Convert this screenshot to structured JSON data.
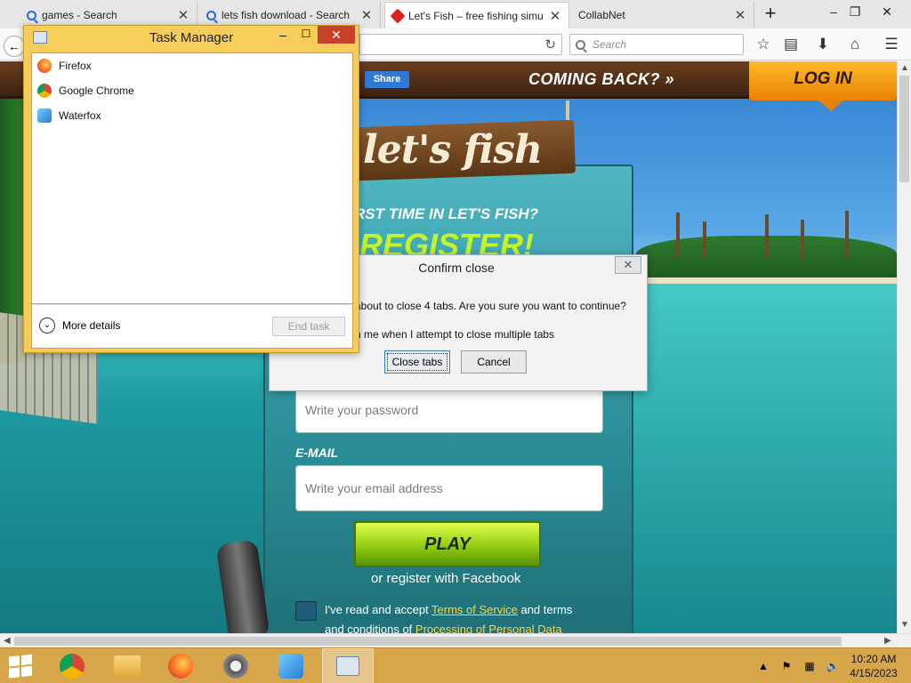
{
  "browser": {
    "tabs": [
      {
        "title": "games - Search",
        "icon": "search-icon"
      },
      {
        "title": "lets fish download - Search",
        "icon": "search-icon"
      },
      {
        "title": "Let's Fish – free fishing simu",
        "icon": "lets-fish-icon",
        "active": true
      },
      {
        "title": "CollabNet",
        "icon": ""
      }
    ],
    "tab_close_glyph": "✕",
    "new_tab_glyph": "+",
    "search_placeholder": "Search"
  },
  "page": {
    "share_label": "Share",
    "coming_back": "COMING BACK? »",
    "login_label": "LOG IN",
    "logo_text": "let's fish",
    "first_time": "RST TIME IN LET'S FISH?",
    "register": "REGISTER!",
    "password_placeholder": "Write your password",
    "email_label": "E-MAIL",
    "email_placeholder": "Write your email address",
    "play_label": "PLAY",
    "facebook_link": "or register with Facebook",
    "tos_prefix": "I've read and accept ",
    "tos_link": "Terms of Service",
    "tos_suffix": " and terms",
    "tos2_prefix": "and conditions of ",
    "tos2_link": "Processing of Personal Data"
  },
  "task_manager": {
    "title": "Task Manager",
    "apps": [
      {
        "name": "Firefox",
        "color": "#ff7a1a"
      },
      {
        "name": "Google Chrome",
        "color": "#3a8f3a"
      },
      {
        "name": "Waterfox",
        "color": "#3aa8e0"
      }
    ],
    "more_details": "More details",
    "end_task": "End task"
  },
  "confirm_dialog": {
    "title": "Confirm close",
    "message": "about to close 4 tabs. Are you sure you want to continue?",
    "warn_text": "n me when I attempt to close multiple tabs",
    "ok_label": "Close tabs",
    "cancel_label": "Cancel"
  },
  "taskbar": {
    "time": "10:20 AM",
    "date": "4/15/2023",
    "accent": "#d7a64a"
  }
}
